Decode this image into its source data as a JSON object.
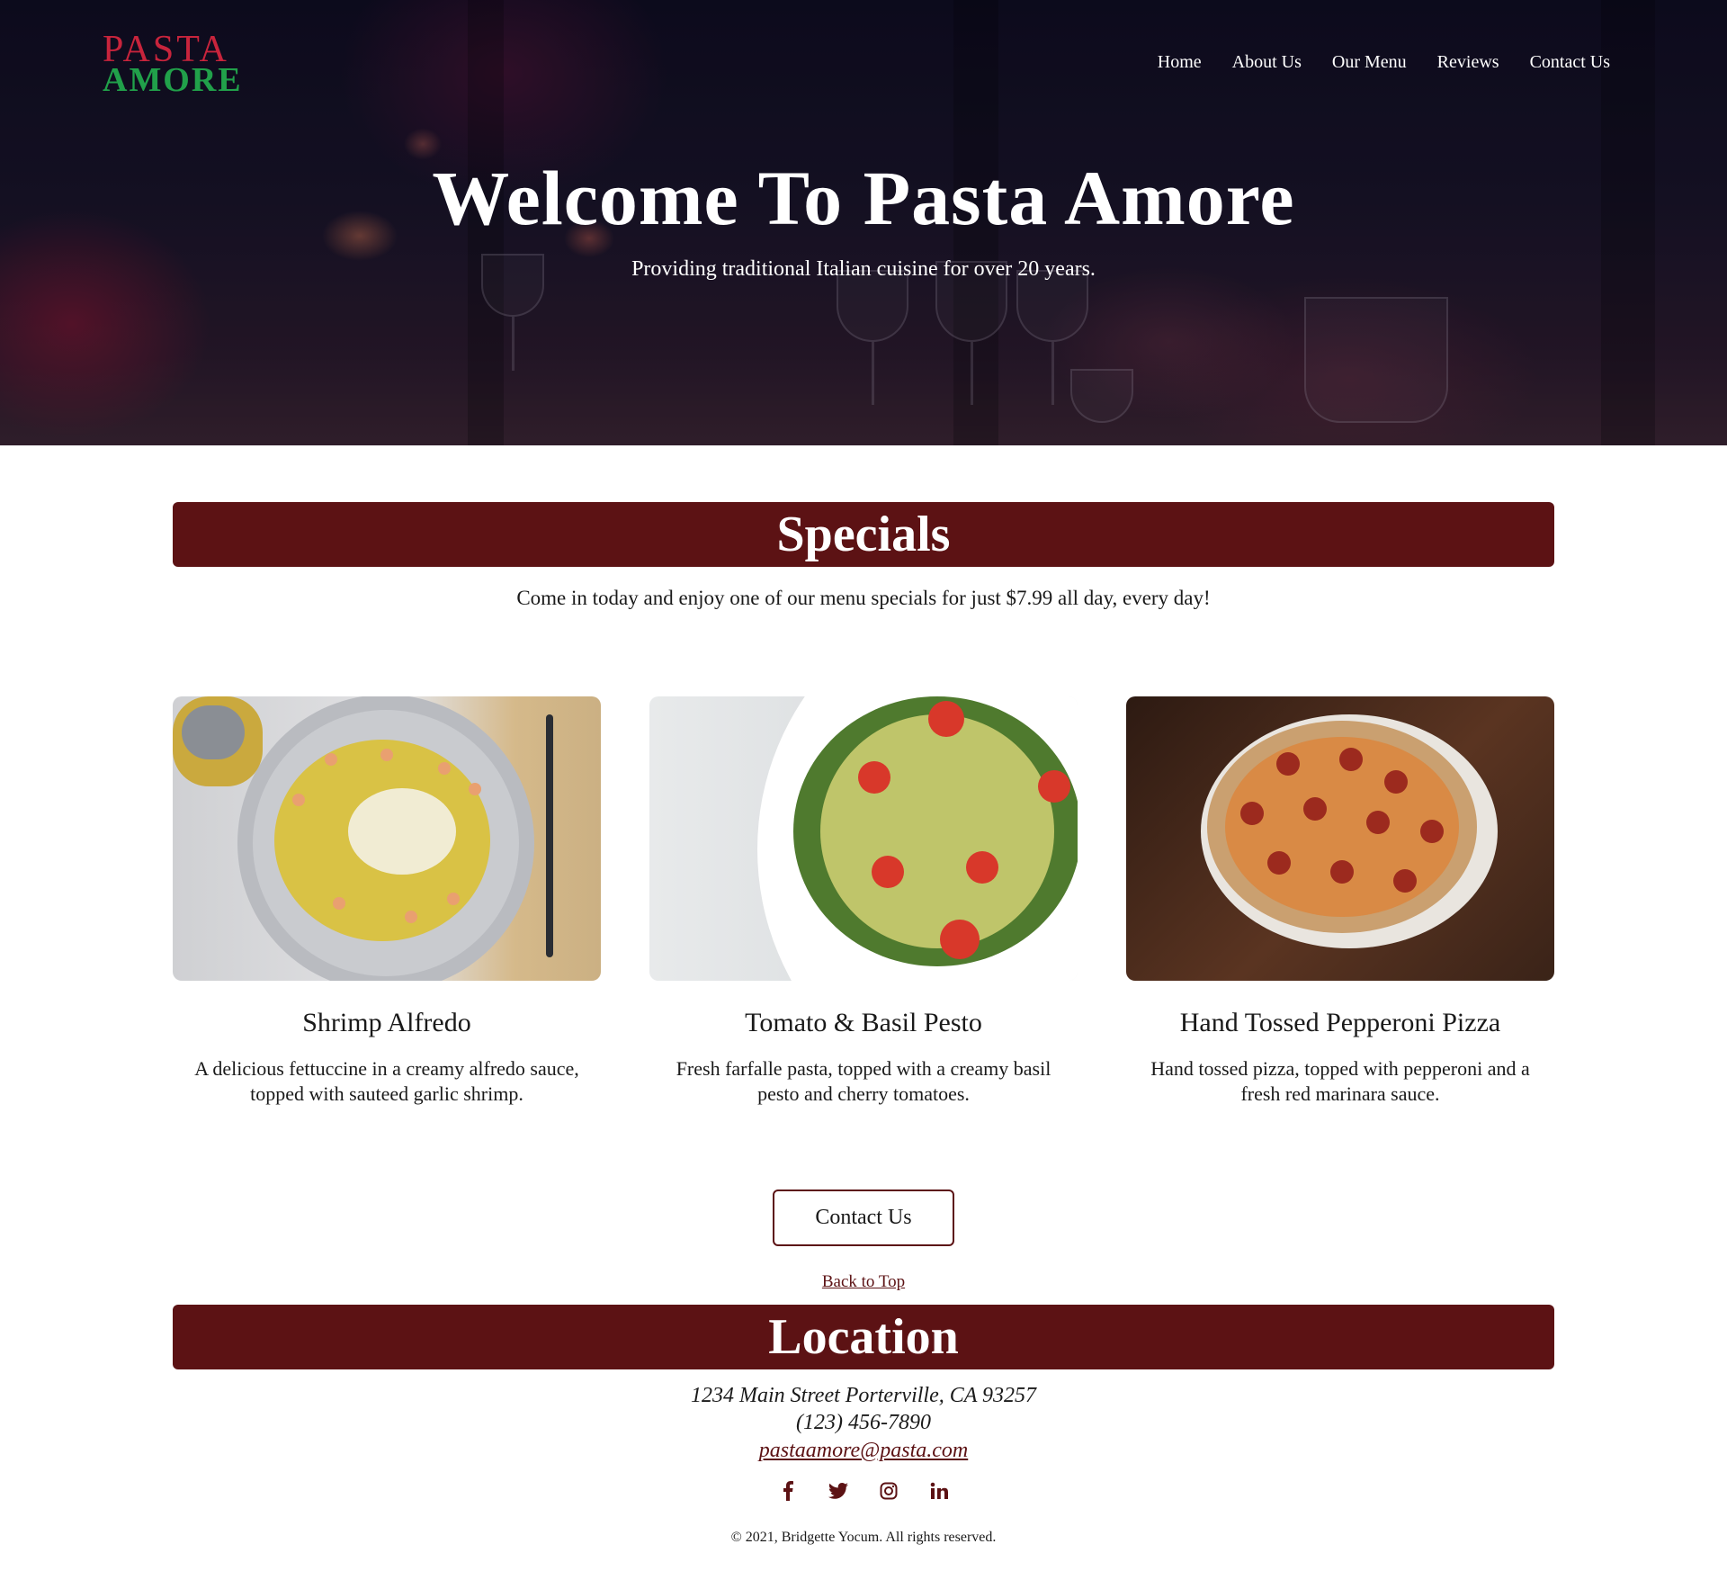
{
  "brand": {
    "logo_line1": "PASTA",
    "logo_line2": "AMORE",
    "primary": "#5c1214",
    "logo_red": "#c8243c",
    "logo_green": "#21a04a"
  },
  "nav": {
    "items": [
      "Home",
      "About Us",
      "Our Menu",
      "Reviews",
      "Contact Us"
    ]
  },
  "hero": {
    "title": "Welcome To Pasta Amore",
    "subtitle": "Providing traditional Italian cuisine for over 20 years."
  },
  "specials": {
    "heading": "Specials",
    "intro": "Come in today and enjoy one of our menu specials for just $7.99 all day, every day!",
    "items": [
      {
        "name": "Shrimp Alfredo",
        "description": "A delicious fettuccine in a creamy alfredo sauce, topped with sauteed garlic shrimp."
      },
      {
        "name": "Tomato & Basil Pesto",
        "description": "Fresh farfalle pasta, topped with a creamy basil pesto and cherry tomatoes."
      },
      {
        "name": "Hand Tossed Pepperoni Pizza",
        "description": "Hand tossed pizza, topped with pepperoni and a fresh red marinara sauce."
      }
    ]
  },
  "cta": {
    "contact_label": "Contact Us",
    "back_to_top": "Back to Top"
  },
  "location": {
    "heading": "Location",
    "address": "1234 Main Street Porterville, CA 93257",
    "phone": "(123) 456-7890",
    "email": "pastaamore@pasta.com"
  },
  "social": {
    "icons": [
      "facebook-icon",
      "twitter-icon",
      "instagram-icon",
      "linkedin-icon"
    ]
  },
  "footer": {
    "copyright": "© 2021, Bridgette Yocum. All rights reserved."
  }
}
